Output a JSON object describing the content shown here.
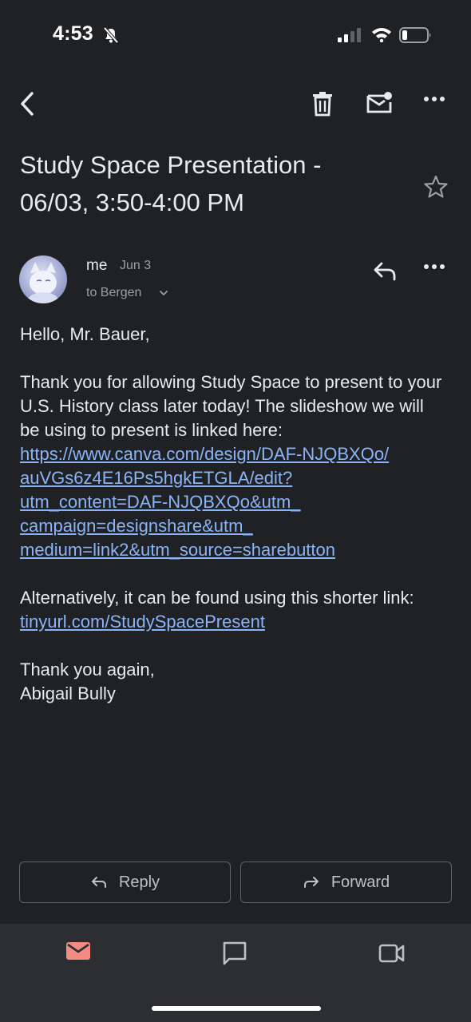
{
  "status_bar": {
    "time": "4:53",
    "battery_level": 0.22
  },
  "toolbar": {
    "back_icon": "back-arrow-icon",
    "delete_icon": "trash-icon",
    "mark_unread_icon": "mail-unread-icon",
    "more_icon": "more-horizontal-icon"
  },
  "email": {
    "subject_line1": "Study Space Presentation -",
    "subject_line2": "06/03, 3:50-4:00 PM",
    "sender": "me",
    "date": "Jun 3",
    "recipients": "to Bergen",
    "greeting": "Hello, Mr. Bauer,",
    "paragraph1_text": "Thank you for allowing Study Space to present to your U.S. History class later today! The slideshow we will be using to present is linked here:",
    "long_link": "https://www.canva.com/design/DAF-NJQBXQo/auVGs6z4E16Ps5hgkETGLA/edit?utm_content=DAF-NJQBXQo&utm_campaign=designshare&utm_medium=link2&utm_source=sharebutton",
    "long_link_lines": [
      "https://www.canva.com/design/DAF-NJQBXQo/",
      "auVGs6z4E16Ps5hgkETGLA/edit?",
      "utm_content=DAF-NJQBXQo&utm_",
      "campaign=designshare&utm_",
      "medium=link2&utm_source=sharebutton"
    ],
    "paragraph2_text": "Alternatively, it can be found using this shorter link:",
    "short_link": "tinyurl.com/StudySpacePresent",
    "closing": "Thank you again,",
    "signature": "Abigail Bully"
  },
  "actions": {
    "reply_label": "Reply",
    "forward_label": "Forward"
  },
  "bottom_nav": {
    "mail_icon": "mail-icon",
    "chat_icon": "chat-icon",
    "meet_icon": "video-camera-icon",
    "active_color": "#f28b82"
  },
  "colors": {
    "background": "#202124",
    "link": "#8ab4f8",
    "text": "#e8eaed",
    "muted": "#9aa0a6"
  }
}
